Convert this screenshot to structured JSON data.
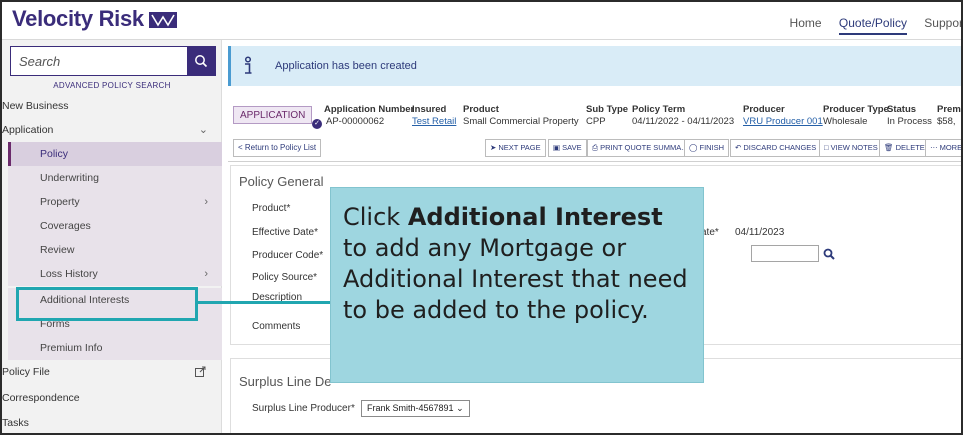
{
  "brand": {
    "name": "Velocity Risk",
    "color": "#3a2c7a"
  },
  "topnav": {
    "items": [
      "Home",
      "Quote/Policy",
      "Suppor"
    ],
    "active_index": 1
  },
  "sidebar": {
    "search": {
      "placeholder": "Search",
      "icon": "search-icon"
    },
    "advanced_search": "ADVANCED POLICY SEARCH",
    "sections": [
      {
        "label": "New Business"
      },
      {
        "label": "Application",
        "expanded": true,
        "chevron": "chevron-down-icon"
      }
    ],
    "sub_items": [
      {
        "label": "Policy",
        "active": true
      },
      {
        "label": "Underwriting"
      },
      {
        "label": "Property",
        "chevron": "chevron-right-icon"
      },
      {
        "label": "Coverages"
      },
      {
        "label": "Review"
      },
      {
        "label": "Loss History",
        "chevron": "chevron-right-icon"
      },
      {
        "label": "Additional Interests",
        "highlighted": true
      },
      {
        "label": "Forms"
      },
      {
        "label": "Premium Info"
      }
    ],
    "bottom_items": [
      {
        "label": "Policy File",
        "icon": "external-link-icon"
      },
      {
        "label": "Correspondence"
      },
      {
        "label": "Tasks"
      }
    ]
  },
  "alert": {
    "text": "Application has been created",
    "icon": "info-icon"
  },
  "application": {
    "badge": "APPLICATION",
    "columns": [
      {
        "header": "Application Number",
        "value": "AP-00000062"
      },
      {
        "header": "Insured",
        "value": "Test Retail",
        "link": true
      },
      {
        "header": "Product",
        "value": "Small Commercial Property"
      },
      {
        "header": "Sub Type",
        "value": "CPP"
      },
      {
        "header": "Policy Term",
        "value": "04/11/2022 - 04/11/2023"
      },
      {
        "header": "Producer",
        "value": "VRU Producer 001",
        "link": true
      },
      {
        "header": "Producer Type",
        "value": "Wholesale"
      },
      {
        "header": "Status",
        "value": "In Process"
      },
      {
        "header": "Prem",
        "value": "$58,"
      }
    ]
  },
  "toolbar": {
    "return": "< Return to Policy List",
    "buttons": [
      "NEXT PAGE",
      "SAVE",
      "PRINT QUOTE SUMMA...",
      "FINISH",
      "DISCARD CHANGES",
      "VIEW NOTES",
      "DELETE",
      "MORE"
    ]
  },
  "policy_general": {
    "title": "Policy General",
    "labels": [
      "Product*",
      "Effective Date*",
      "Producer Code*",
      "Policy Source*",
      "Description",
      "Comments"
    ],
    "expiration_label_fragment": "ate*",
    "expiration_value": "04/11/2023"
  },
  "surplus": {
    "title": "Surplus Line De",
    "producer_label": "Surplus Line Producer*",
    "producer_value": "Frank Smith-4567891"
  },
  "callout": {
    "pre": "Click ",
    "bold": "Additional Interest",
    "post": " to add any Mortgage or Additional Interest that need to be added to the policy.",
    "color": "#9ed6e0",
    "accent": "#20a6b0"
  }
}
